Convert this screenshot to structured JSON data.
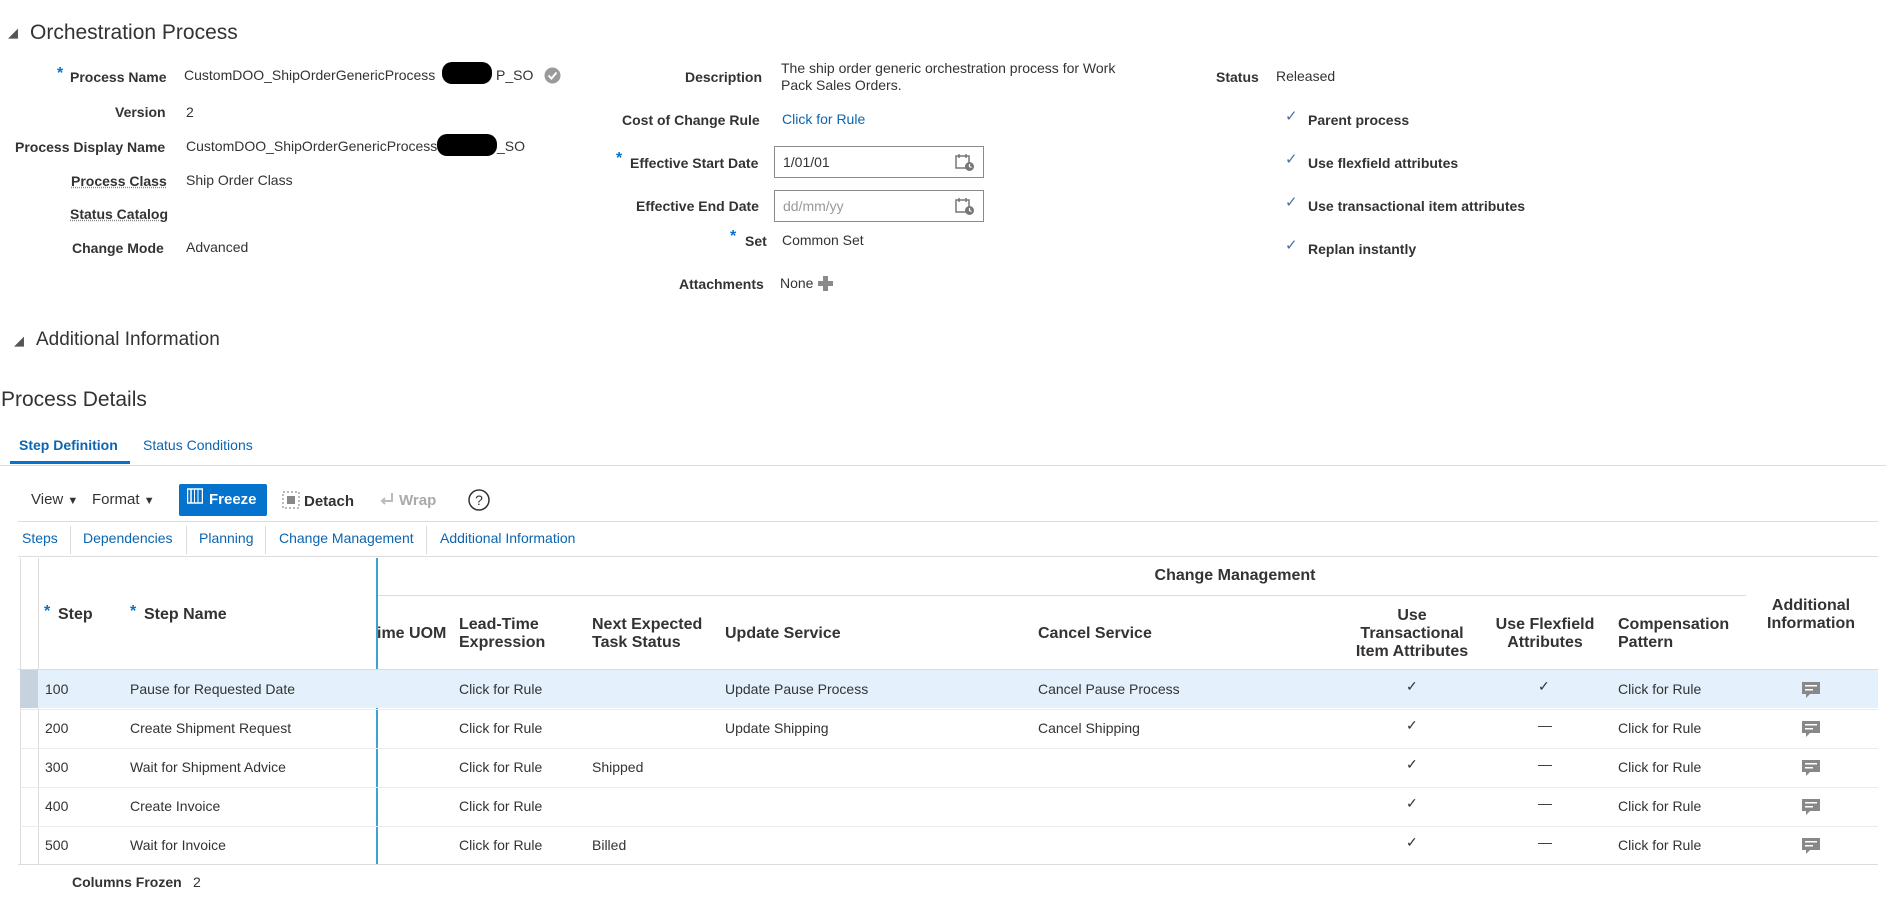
{
  "orchestration": {
    "title": "Orchestration Process",
    "process_name": {
      "label": "Process Name",
      "value_prefix": "CustomDOO_ShipOrderGenericProcess",
      "value_suffix": "P_SO"
    },
    "version": {
      "label": "Version",
      "value": "2"
    },
    "display_name": {
      "label": "Process Display Name",
      "value_prefix": "CustomDOO_ShipOrderGenericProcess",
      "value_suffix": "_SO"
    },
    "process_class": {
      "label": "Process Class",
      "value": "Ship Order Class"
    },
    "status_catalog": {
      "label": "Status Catalog",
      "value": ""
    },
    "change_mode": {
      "label": "Change Mode",
      "value": "Advanced"
    },
    "description": {
      "label": "Description",
      "line1": "The ship order generic orchestration process for Work",
      "line2": "Pack Sales Orders."
    },
    "cost_rule": {
      "label": "Cost of Change Rule",
      "value": "Click for Rule"
    },
    "start_date": {
      "label": "Effective Start Date",
      "value": "1/01/01"
    },
    "end_date": {
      "label": "Effective End Date",
      "placeholder": "dd/mm/yy"
    },
    "set": {
      "label": "Set",
      "value": "Common Set"
    },
    "attachments": {
      "label": "Attachments",
      "value": "None"
    },
    "status": {
      "label": "Status",
      "value": "Released"
    },
    "flags": [
      "Parent process",
      "Use flexfield attributes",
      "Use transactional item attributes",
      "Replan instantly"
    ]
  },
  "additional_info": {
    "title": "Additional Information"
  },
  "process_details": {
    "title": "Process Details",
    "tabs": [
      "Step Definition",
      "Status Conditions"
    ],
    "toolbar": {
      "view": "View",
      "format": "Format",
      "freeze": "Freeze",
      "detach": "Detach",
      "wrap": "Wrap"
    },
    "subtabs": [
      "Steps",
      "Dependencies",
      "Planning",
      "Change Management",
      "Additional Information"
    ],
    "group_header": "Change Management",
    "columns": {
      "step": "Step",
      "step_name": "Step Name",
      "time_uom": "ime UOM",
      "lead_time": "Lead-Time Expression",
      "next_status": "Next Expected Task Status",
      "update_service": "Update Service",
      "cancel_service": "Cancel Service",
      "use_trans": "Use Transactional Item Attributes",
      "use_flex": "Use Flexfield Attributes",
      "compensation": "Compensation Pattern",
      "additional": "Additional Information"
    },
    "rows": [
      {
        "step": "100",
        "name": "Pause for Requested Date",
        "lead": "Click for Rule",
        "next": "",
        "update": "Update Pause Process",
        "cancel": "Cancel Pause Process",
        "trans": "✓",
        "flex": "✓",
        "comp": "Click for Rule"
      },
      {
        "step": "200",
        "name": "Create Shipment Request",
        "lead": "Click for Rule",
        "next": "",
        "update": "Update Shipping",
        "cancel": "Cancel Shipping",
        "trans": "✓",
        "flex": "—",
        "comp": "Click for Rule"
      },
      {
        "step": "300",
        "name": "Wait for Shipment Advice",
        "lead": "Click for Rule",
        "next": "Shipped",
        "update": "",
        "cancel": "",
        "trans": "✓",
        "flex": "—",
        "comp": "Click for Rule"
      },
      {
        "step": "400",
        "name": "Create Invoice",
        "lead": "Click for Rule",
        "next": "",
        "update": "",
        "cancel": "",
        "trans": "✓",
        "flex": "—",
        "comp": "Click for Rule"
      },
      {
        "step": "500",
        "name": "Wait for Invoice",
        "lead": "Click for Rule",
        "next": "Billed",
        "update": "",
        "cancel": "",
        "trans": "✓",
        "flex": "—",
        "comp": "Click for Rule"
      }
    ],
    "columns_frozen": {
      "label": "Columns Frozen",
      "value": "2"
    }
  }
}
